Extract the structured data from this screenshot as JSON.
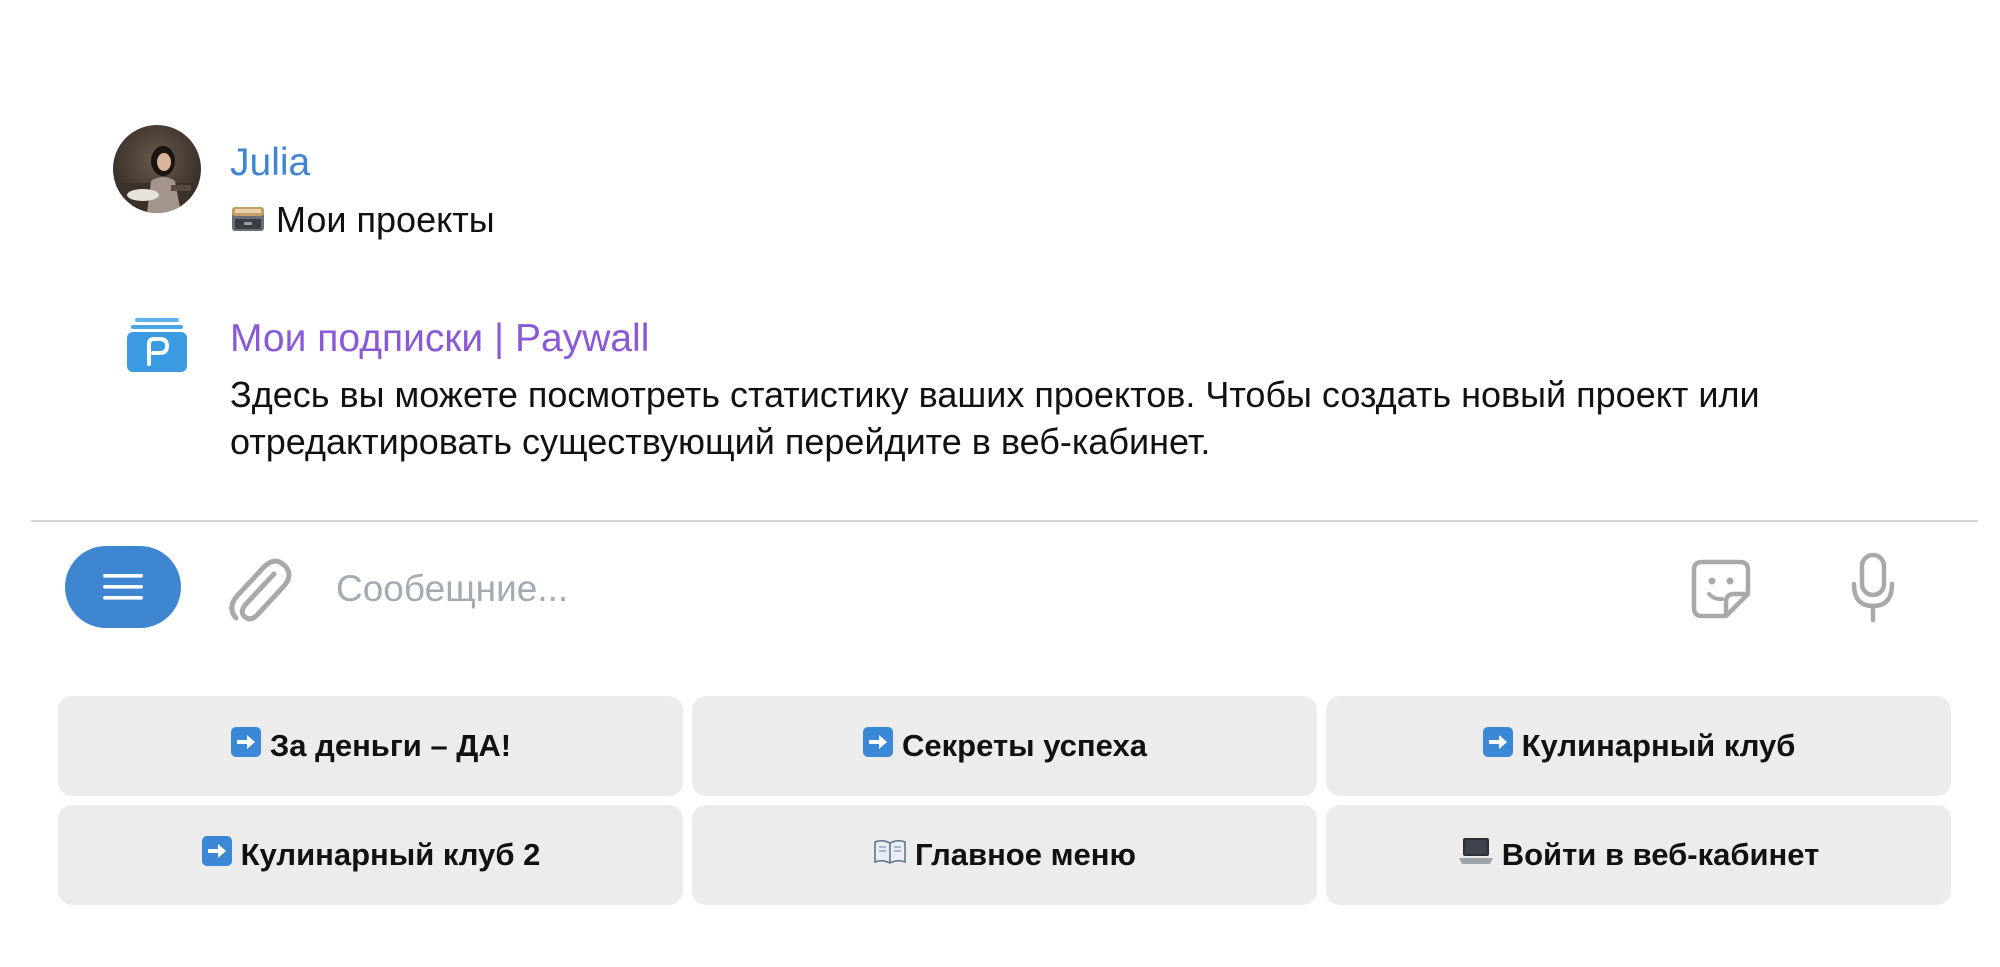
{
  "messages": [
    {
      "sender": "Julia",
      "sender_color": "#3f86d1",
      "avatar_icon": "user-photo-avatar",
      "emoji_icon": "card-file-box-emoji",
      "text": "Мои проекты"
    },
    {
      "sender": "Мои подписки | Paywall",
      "sender_color": "#8a5ad6",
      "avatar_icon": "paywall-bot-logo",
      "text": "Здесь вы можете посмотреть статистику ваших проектов. Чтобы создать новый проект или отредактировать существующий перейдите в веб-кабинет."
    }
  ],
  "composer": {
    "menu_icon": "hamburger-menu-icon",
    "attach_icon": "paperclip-icon",
    "placeholder": "Сообещние...",
    "sticker_icon": "sticker-icon",
    "mic_icon": "microphone-icon"
  },
  "keyboard": [
    {
      "icon": "right-arrow-emoji",
      "label": "За деньги – ДА!"
    },
    {
      "icon": "right-arrow-emoji",
      "label": "Секреты успеха"
    },
    {
      "icon": "right-arrow-emoji",
      "label": "Кулинарный клуб"
    },
    {
      "icon": "right-arrow-emoji",
      "label": "Кулинарный клуб 2"
    },
    {
      "icon": "open-book-emoji",
      "label": "Главное меню"
    },
    {
      "icon": "laptop-emoji",
      "label": "Войти в веб-кабинет"
    }
  ],
  "colors": {
    "accent": "#3f86d1",
    "bot_name": "#8a5ad6",
    "button_bg": "#ececec",
    "placeholder": "#a3abb3"
  }
}
